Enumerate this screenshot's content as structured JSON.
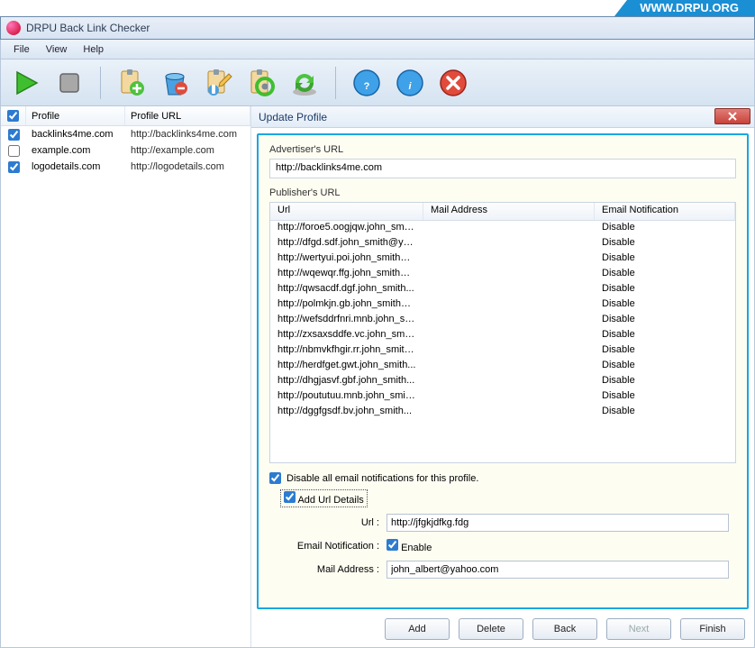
{
  "banner": {
    "text": "WWW.DRPU.ORG"
  },
  "titlebar": {
    "title": "DRPU Back Link Checker"
  },
  "menu": {
    "file": "File",
    "view": "View",
    "help": "Help"
  },
  "toolbar_icons": {
    "play": "play-icon",
    "stop": "stop-icon",
    "add_profile": "add-profile-icon",
    "delete_profile": "delete-profile-icon",
    "edit": "edit-icon",
    "settings": "settings-icon",
    "refresh": "refresh-icon",
    "help": "help-icon",
    "info": "info-icon",
    "exit": "exit-icon"
  },
  "profile_list": {
    "headers": {
      "profile": "Profile",
      "url": "Profile URL"
    },
    "rows": [
      {
        "checked": true,
        "profile": "backlinks4me.com",
        "url": "http://backlinks4me.com"
      },
      {
        "checked": false,
        "profile": "example.com",
        "url": "http://example.com"
      },
      {
        "checked": true,
        "profile": "logodetails.com",
        "url": "http://logodetails.com"
      }
    ]
  },
  "panel": {
    "title": "Update Profile",
    "advertiser_label": "Advertiser's URL",
    "advertiser_url": "http://backlinks4me.com",
    "publisher_label": "Publisher's URL",
    "columns": {
      "url": "Url",
      "mail": "Mail Address",
      "notif": "Email Notification"
    },
    "rows": [
      {
        "url": "http://foroe5.oogjqw.john_smit...",
        "mail": "",
        "notif": "Disable"
      },
      {
        "url": "http://dfgd.sdf.john_smith@ya...",
        "mail": "",
        "notif": "Disable"
      },
      {
        "url": "http://wertyui.poi.john_smith@...",
        "mail": "",
        "notif": "Disable"
      },
      {
        "url": "http://wqewqr.ffg.john_smith@...",
        "mail": "",
        "notif": "Disable"
      },
      {
        "url": "http://qwsacdf.dgf.john_smith...",
        "mail": "",
        "notif": "Disable"
      },
      {
        "url": "http://polmkjn.gb.john_smith@...",
        "mail": "",
        "notif": "Disable"
      },
      {
        "url": "http://wefsddrfnri.mnb.john_sm...",
        "mail": "",
        "notif": "Disable"
      },
      {
        "url": "http://zxsaxsddfe.vc.john_smit...",
        "mail": "",
        "notif": "Disable"
      },
      {
        "url": "http://nbmvkfhgir.rr.john_smith...",
        "mail": "",
        "notif": "Disable"
      },
      {
        "url": "http://herdfget.gwt.john_smith...",
        "mail": "",
        "notif": "Disable"
      },
      {
        "url": "http://dhgjasvf.gbf.john_smith...",
        "mail": "",
        "notif": "Disable"
      },
      {
        "url": "http://poututuu.mnb.john_smit...",
        "mail": "",
        "notif": "Disable"
      },
      {
        "url": "http://dggfgsdf.bv.john_smith...",
        "mail": "",
        "notif": "Disable"
      }
    ],
    "disable_all_label": "Disable all email notifications for this profile.",
    "disable_all_checked": true,
    "add_url_details_label": "Add Url Details",
    "add_url_details_checked": true,
    "url_label": "Url :",
    "url_value": "http://jfgkjdfkg.fdg",
    "notif_label": "Email Notification :",
    "enable_label": "Enable",
    "enable_checked": true,
    "mail_label": "Mail Address :",
    "mail_value": "john_albert@yahoo.com"
  },
  "buttons": {
    "add": "Add",
    "delete": "Delete",
    "back": "Back",
    "next": "Next",
    "finish": "Finish"
  }
}
